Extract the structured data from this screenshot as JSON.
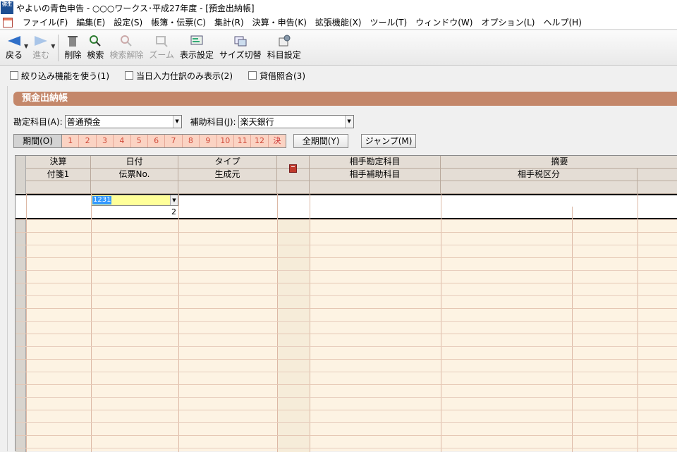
{
  "window": {
    "title": "やよいの青色申告 - ○○○ワークス･平成27年度 - [預金出納帳]",
    "app_icon_text": "弥生"
  },
  "menu": [
    "ファイル(F)",
    "編集(E)",
    "設定(S)",
    "帳簿・伝票(C)",
    "集計(R)",
    "決算・申告(K)",
    "拡張機能(X)",
    "ツール(T)",
    "ウィンドウ(W)",
    "オプション(L)",
    "ヘルプ(H)"
  ],
  "toolbar": {
    "back": "戻る",
    "forward": "進む",
    "delete": "削除",
    "search": "検索",
    "clear_search": "検索解除",
    "zoom": "ズーム",
    "display_settings": "表示設定",
    "size_toggle": "サイズ切替",
    "account_settings": "科目設定"
  },
  "options": {
    "filter": "絞り込み機能を使う(1)",
    "today_only": "当日入力仕訳のみ表示(2)",
    "reconcile": "貸借照合(3)"
  },
  "panel": {
    "title": "預金出納帳",
    "account_label": "勘定科目(A):",
    "account_value": "普通預金",
    "sub_account_label": "補助科目(J):",
    "sub_account_value": "楽天銀行",
    "period_label": "期間(O)",
    "months": [
      "1",
      "2",
      "3",
      "4",
      "5",
      "6",
      "7",
      "8",
      "9",
      "10",
      "11",
      "12",
      "決"
    ],
    "all_period_button": "全期間(Y)",
    "jump_button": "ジャンプ(M)"
  },
  "grid": {
    "header_row1": [
      "決算",
      "日付",
      "タイプ",
      "",
      "相手勘定科目",
      "摘要"
    ],
    "header_row2": [
      "付箋1",
      "伝票No.",
      "生成元",
      "",
      "相手補助科目",
      "相手税区分"
    ],
    "active_row": {
      "date_value": "1231",
      "voucher_no": "2"
    }
  },
  "colors": {
    "panel_header": "#c4876a",
    "grid_background": "#fdf3e3",
    "period_cells": "#fbd3c3",
    "date_input_highlight": "#ffff99"
  }
}
